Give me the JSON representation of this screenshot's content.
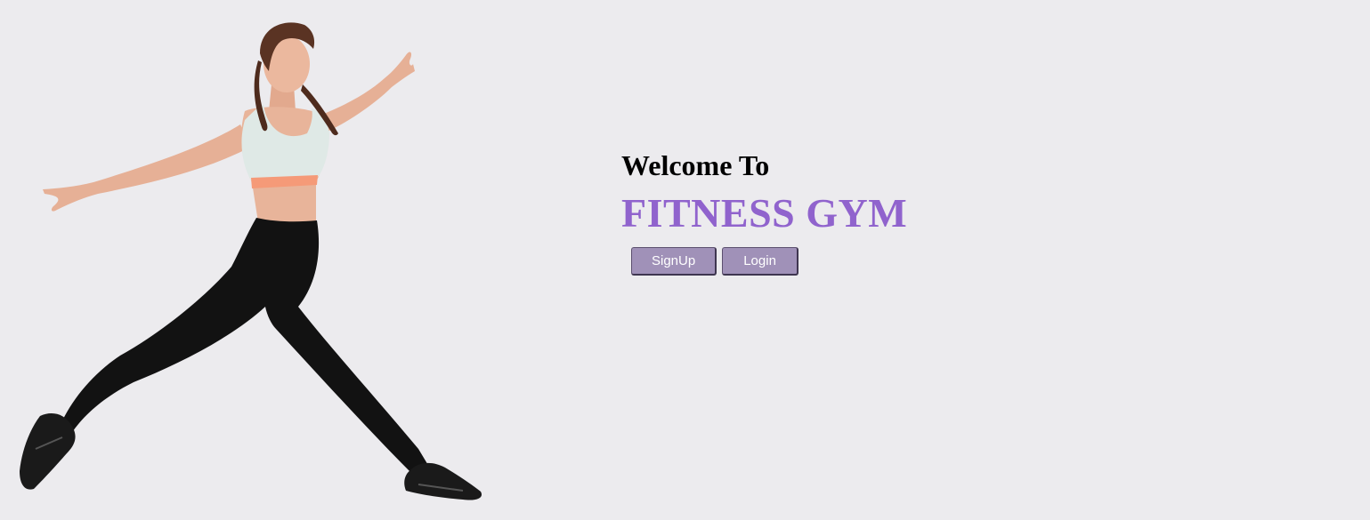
{
  "hero": {
    "image_subject": "woman-jumping-fitness",
    "colors": {
      "skin": "#e8b49a",
      "top": "#dfe9e6",
      "top_band": "#f59a78",
      "leggings": "#121212",
      "hair": "#5a3323",
      "shoes": "#1a1a1a"
    }
  },
  "welcome": {
    "line1": "Welcome To",
    "title": "FITNESS GYM"
  },
  "actions": {
    "signup_label": "SignUp",
    "login_label": "Login"
  },
  "theme": {
    "background": "#ecebee",
    "accent": "#9063cd",
    "button_bg": "#a091b8"
  }
}
